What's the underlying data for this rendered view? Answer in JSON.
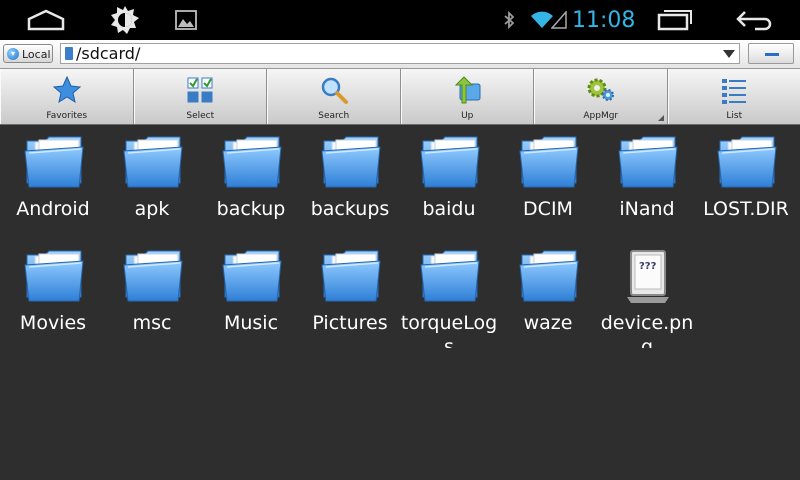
{
  "status_bar": {
    "time": "11:08",
    "icons": [
      "home-icon",
      "brightness-icon",
      "gallery-icon",
      "bluetooth-icon",
      "wifi-icon",
      "signal-icon",
      "recent-apps-icon",
      "back-icon"
    ]
  },
  "address_bar": {
    "local_label": "Local",
    "path": "/sdcard/"
  },
  "toolbar": {
    "buttons": [
      {
        "label": "Favorites",
        "icon": "star-icon"
      },
      {
        "label": "Select",
        "icon": "select-grid-icon"
      },
      {
        "label": "Search",
        "icon": "magnifier-icon"
      },
      {
        "label": "Up",
        "icon": "folder-up-icon"
      },
      {
        "label": "AppMgr",
        "icon": "gears-icon"
      },
      {
        "label": "List",
        "icon": "list-icon"
      }
    ]
  },
  "files": [
    {
      "name": "Android",
      "type": "folder"
    },
    {
      "name": "apk",
      "type": "folder"
    },
    {
      "name": "backup",
      "type": "folder"
    },
    {
      "name": "backups",
      "type": "folder"
    },
    {
      "name": "baidu",
      "type": "folder"
    },
    {
      "name": "DCIM",
      "type": "folder"
    },
    {
      "name": "iNand",
      "type": "folder"
    },
    {
      "name": "LOST.DIR",
      "type": "folder"
    },
    {
      "name": "Movies",
      "type": "folder"
    },
    {
      "name": "msc",
      "type": "folder"
    },
    {
      "name": "Music",
      "type": "folder"
    },
    {
      "name": "Pictures",
      "type": "folder"
    },
    {
      "name": "torqueLogs",
      "type": "folder"
    },
    {
      "name": "waze",
      "type": "folder"
    },
    {
      "name": "device.png",
      "type": "unknown-file"
    }
  ],
  "colors": {
    "accent": "#33b5e5",
    "background": "#2e2e2e"
  }
}
